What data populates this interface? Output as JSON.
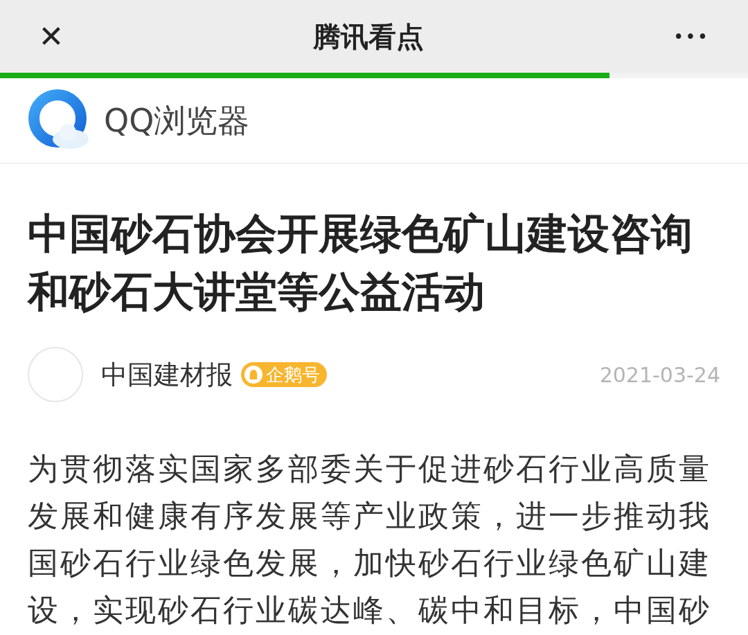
{
  "header": {
    "title": "腾讯看点",
    "close": "✕",
    "more": "•••"
  },
  "progress": {
    "level": 0.815
  },
  "brand": {
    "name": "QQ浏览器"
  },
  "article": {
    "title_lines": [
      "中国砂石协会开展绿色矿山建设咨询",
      "和砂石大讲堂等公益活动"
    ],
    "author": "中国建材报",
    "badge": "企鹅号",
    "date": "2021-03-24",
    "body_lines": [
      "为贯彻落实国家多部委关于促进砂石行业高质量",
      "发展和健康有序发展等产业政策，进一步推动我",
      "国砂石行业绿色发展，加快砂石行业绿色矿山建",
      "设，实现砂石行业碳达峰、碳中和目标，中国砂"
    ]
  }
}
